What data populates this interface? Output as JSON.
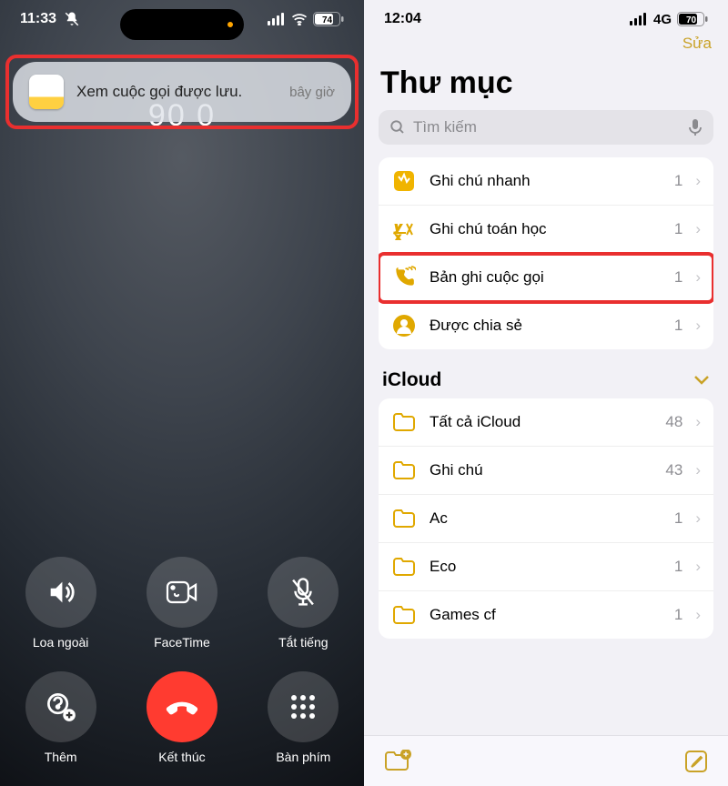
{
  "left": {
    "status": {
      "time": "11:33",
      "battery": "74"
    },
    "notification": {
      "message": "Xem cuộc gọi được lưu.",
      "time": "bây giờ"
    },
    "number_shown": "90 0",
    "buttons": {
      "speaker": "Loa ngoài",
      "facetime": "FaceTime",
      "mute": "Tắt tiếng",
      "more": "Thêm",
      "end": "Kết thúc",
      "keypad": "Bàn phím"
    }
  },
  "right": {
    "status": {
      "time": "12:04",
      "net": "4G",
      "battery": "70"
    },
    "edit": "Sửa",
    "title": "Thư mục",
    "search_placeholder": "Tìm kiếm",
    "top_folders": [
      {
        "name": "Ghi chú nhanh",
        "count": "1"
      },
      {
        "name": "Ghi chú toán học",
        "count": "1"
      },
      {
        "name": "Bản ghi cuộc gọi",
        "count": "1"
      },
      {
        "name": "Được chia sẻ",
        "count": "1"
      }
    ],
    "section": "iCloud",
    "icloud_folders": [
      {
        "name": "Tất cả iCloud",
        "count": "48"
      },
      {
        "name": "Ghi chú",
        "count": "43"
      },
      {
        "name": "Ac",
        "count": "1"
      },
      {
        "name": "Eco",
        "count": "1"
      },
      {
        "name": "Games cf",
        "count": "1"
      }
    ]
  }
}
